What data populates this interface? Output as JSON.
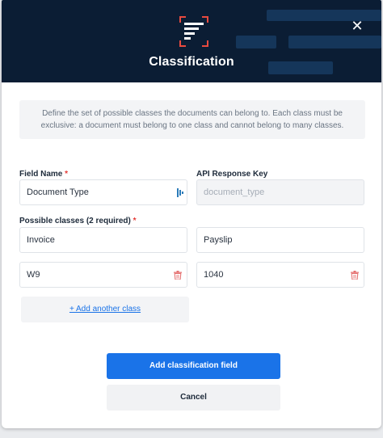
{
  "modal": {
    "title": "Classification",
    "close_icon": "close-icon",
    "logo_icon": "classification-logo-icon",
    "description": "Define the set of possible classes the documents can belong to. Each class must be exclusive: a document must belong to one class and cannot belong to many classes."
  },
  "field_name": {
    "label": "Field Name",
    "required_mark": "*",
    "value": "Document Type"
  },
  "api_key": {
    "label": "API Response Key",
    "placeholder": "document_type"
  },
  "classes": {
    "label": "Possible classes (2 required)",
    "required_mark": "*",
    "items": [
      "Invoice",
      "Payslip",
      "W9",
      "1040"
    ],
    "delete_icon": "trash-icon",
    "add_label": "+ Add another class"
  },
  "buttons": {
    "submit": "Add classification field",
    "cancel": "Cancel"
  },
  "colors": {
    "header_bg": "#0b1d34",
    "primary": "#1a73e8",
    "required": "#e53935",
    "delete": "#e57373"
  }
}
